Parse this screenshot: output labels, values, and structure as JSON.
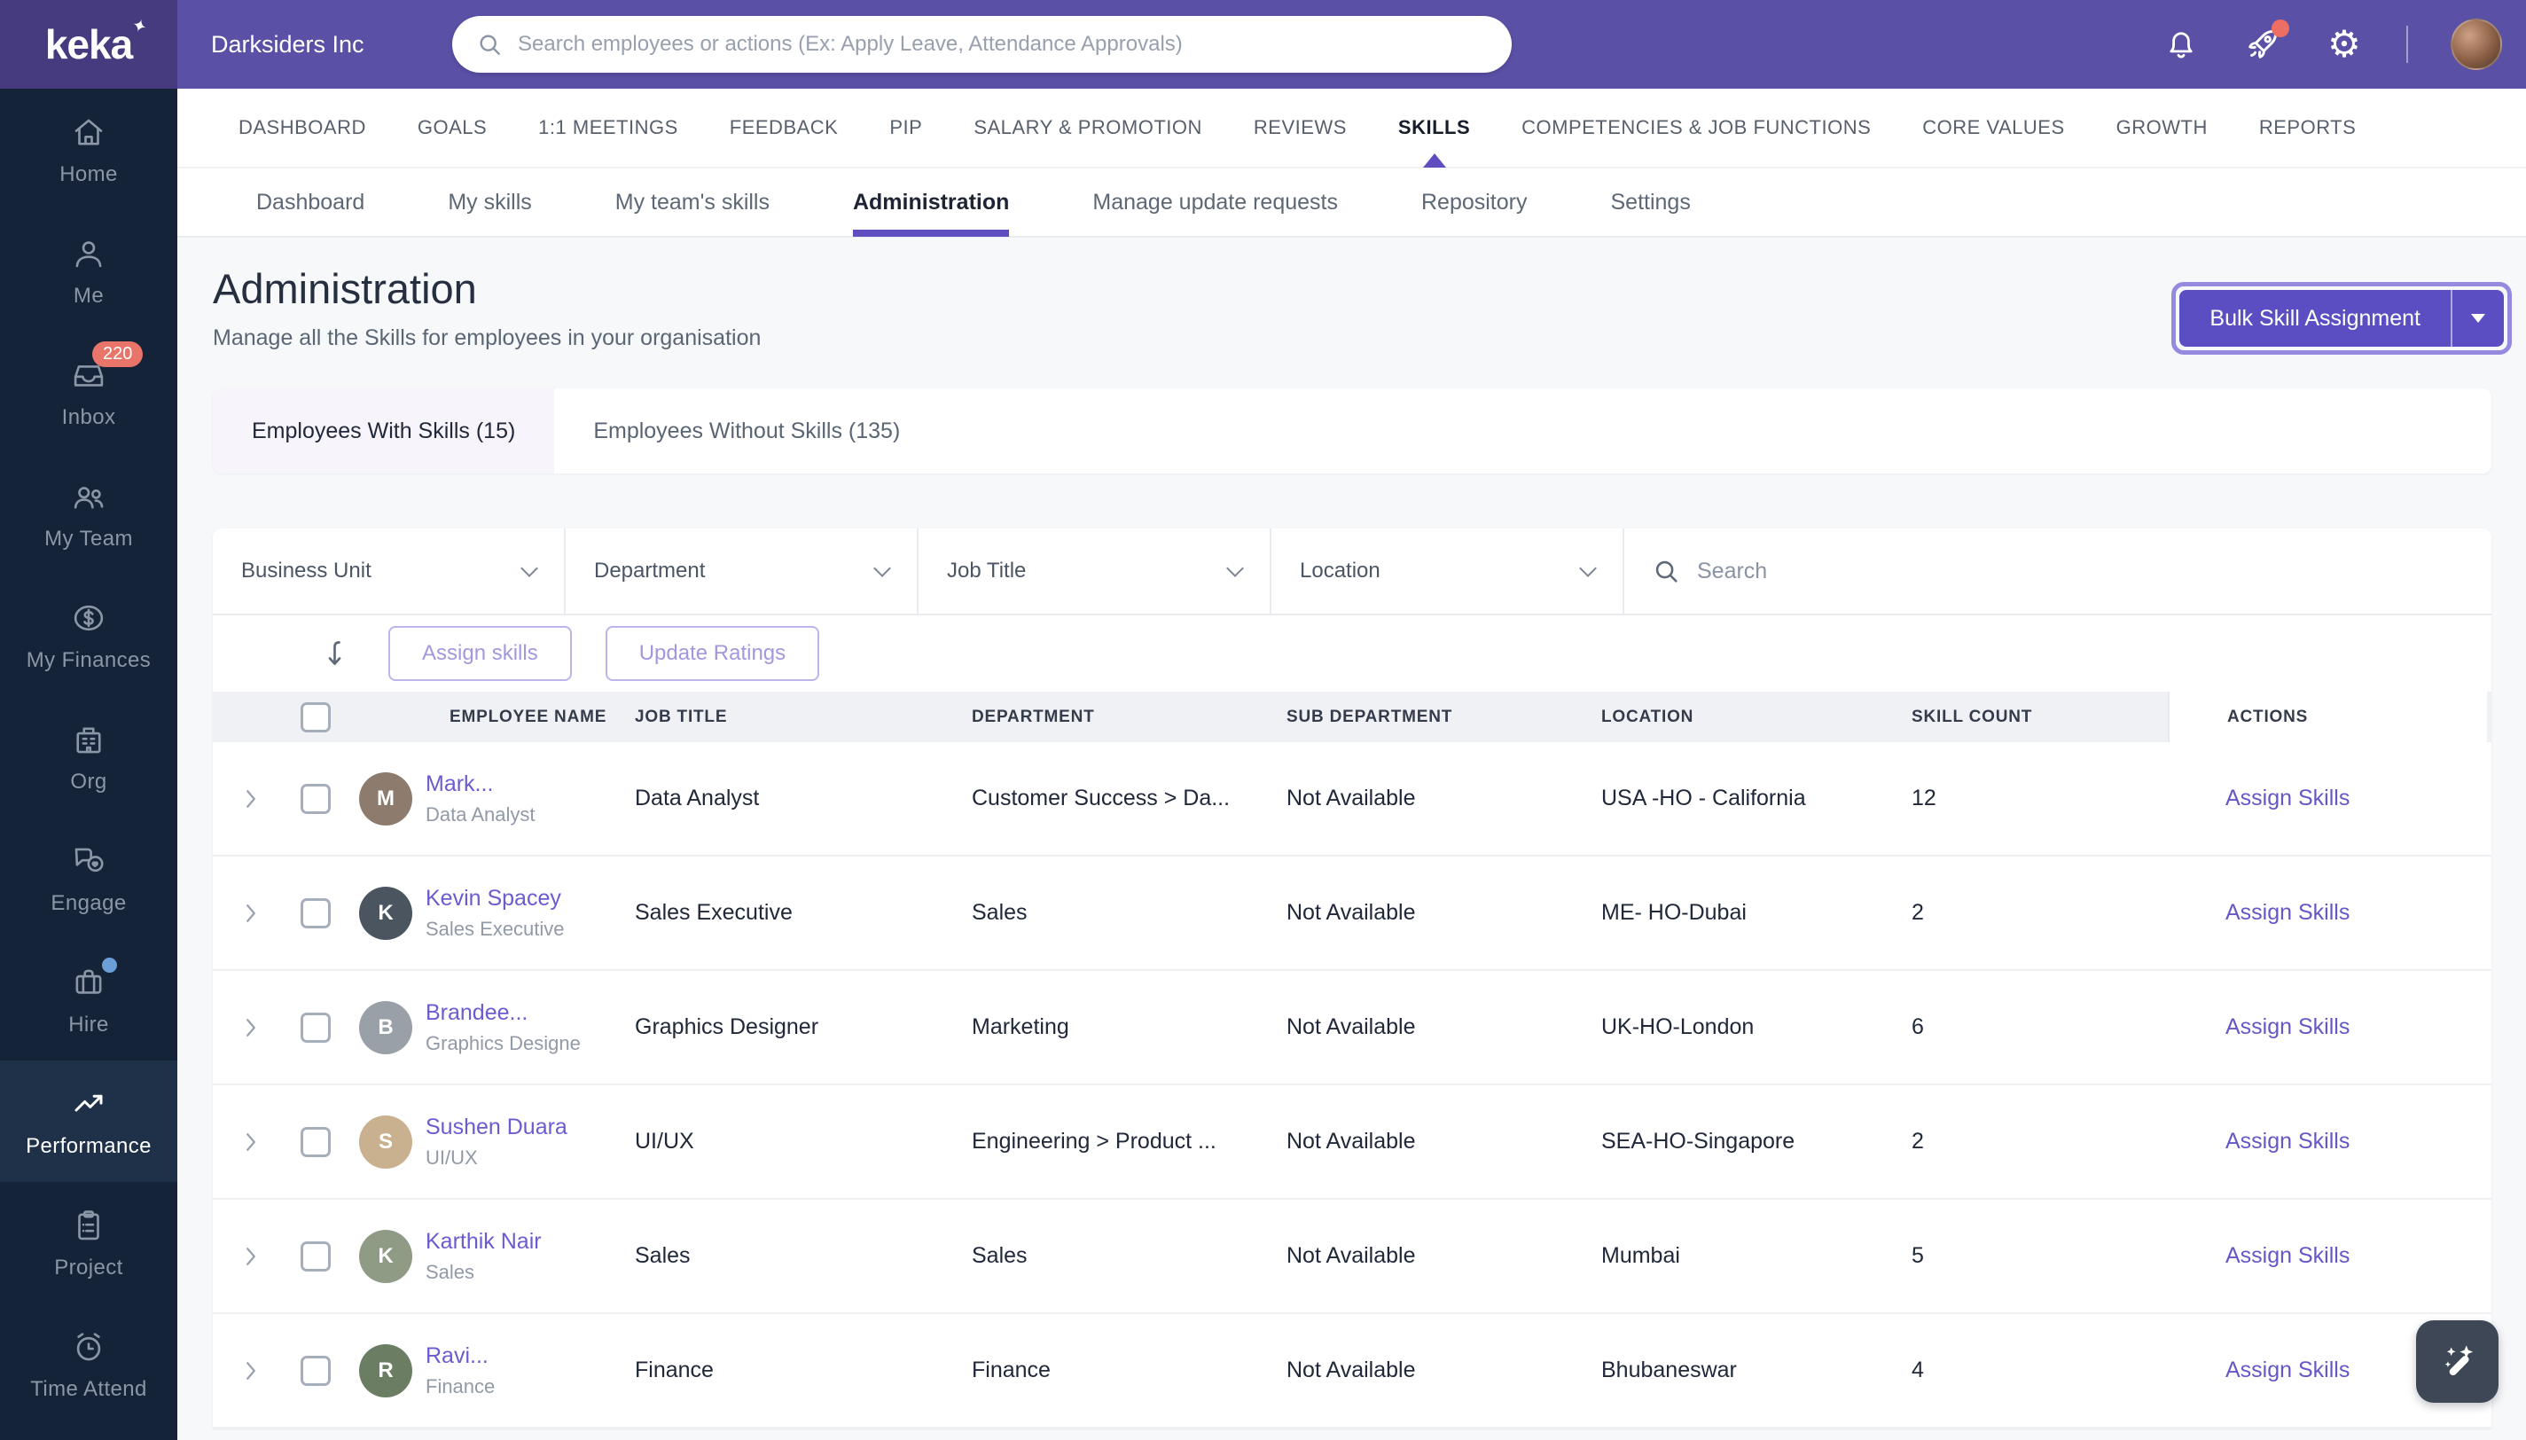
{
  "topbar": {
    "logo": "keka",
    "logo_spark": "✦",
    "company": "Darksiders Inc",
    "search_placeholder": "Search employees or actions (Ex: Apply Leave, Attendance Approvals)",
    "gear_glyph": "⚙"
  },
  "sidebar": {
    "items": [
      {
        "label": "Home"
      },
      {
        "label": "Me"
      },
      {
        "label": "Inbox",
        "badge": "220"
      },
      {
        "label": "My Team"
      },
      {
        "label": "My Finances"
      },
      {
        "label": "Org"
      },
      {
        "label": "Engage"
      },
      {
        "label": "Hire"
      },
      {
        "label": "Performance",
        "active": true
      },
      {
        "label": "Project"
      },
      {
        "label": "Time Attend"
      }
    ]
  },
  "main_nav": {
    "items": [
      "DASHBOARD",
      "GOALS",
      "1:1 MEETINGS",
      "FEEDBACK",
      "PIP",
      "SALARY & PROMOTION",
      "REVIEWS",
      "SKILLS",
      "COMPETENCIES & JOB FUNCTIONS",
      "CORE VALUES",
      "GROWTH",
      "REPORTS"
    ],
    "active": "SKILLS"
  },
  "sub_nav": {
    "items": [
      "Dashboard",
      "My skills",
      "My team's skills",
      "Administration",
      "Manage update requests",
      "Repository",
      "Settings"
    ],
    "active": "Administration"
  },
  "page": {
    "title": "Administration",
    "subtitle": "Manage all the Skills for employees in your organisation",
    "primary_button": "Bulk Skill Assignment"
  },
  "tabs": {
    "with_skills": "Employees With Skills (15)",
    "without_skills": "Employees Without Skills (135)"
  },
  "filters": {
    "business_unit": "Business Unit",
    "department": "Department",
    "job_title": "Job Title",
    "location": "Location",
    "search_placeholder": "Search"
  },
  "toolbar": {
    "assign_label": "Assign skills",
    "update_label": "Update Ratings"
  },
  "table": {
    "headers": [
      "EMPLOYEE NAME",
      "JOB TITLE",
      "DEPARTMENT",
      "SUB DEPARTMENT",
      "LOCATION",
      "SKILL COUNT",
      "ACTIONS"
    ],
    "rows": [
      {
        "initials": "M",
        "avatar_color": "#8d7b6d",
        "name": "Mark...",
        "subtitle": "Data Analyst",
        "job_title": "Data Analyst",
        "department": "Customer Success > Da...",
        "sub_department": "Not Available",
        "location": "USA -HO - California",
        "skill_count": "12",
        "action": "Assign Skills"
      },
      {
        "initials": "K",
        "avatar_color": "#4a5560",
        "name": "Kevin Spacey",
        "subtitle": "Sales Executive",
        "job_title": "Sales Executive",
        "department": "Sales",
        "sub_department": "Not Available",
        "location": "ME- HO-Dubai",
        "skill_count": "2",
        "action": "Assign Skills"
      },
      {
        "initials": "B",
        "avatar_color": "#9aa0a8",
        "name": "Brandee...",
        "subtitle": "Graphics Designe",
        "job_title": "Graphics Designer",
        "department": "Marketing",
        "sub_department": "Not Available",
        "location": "UK-HO-London",
        "skill_count": "6",
        "action": "Assign Skills"
      },
      {
        "initials": "S",
        "avatar_color": "#c9b18f",
        "name": "Sushen Duara",
        "subtitle": "UI/UX",
        "job_title": "UI/UX",
        "department": "Engineering > Product ...",
        "sub_department": "Not Available",
        "location": "SEA-HO-Singapore",
        "skill_count": "2",
        "action": "Assign Skills"
      },
      {
        "initials": "K",
        "avatar_color": "#8f9b85",
        "name": "Karthik Nair",
        "subtitle": "Sales",
        "job_title": "Sales",
        "department": "Sales",
        "sub_department": "Not Available",
        "location": "Mumbai",
        "skill_count": "5",
        "action": "Assign Skills"
      },
      {
        "initials": "R",
        "avatar_color": "#6b7d62",
        "name": "Ravi...",
        "subtitle": "Finance",
        "job_title": "Finance",
        "department": "Finance",
        "sub_department": "Not Available",
        "location": "Bhubaneswar",
        "skill_count": "4",
        "action": "Assign Skills"
      }
    ]
  },
  "colors": {
    "topbar_purple": "#5a50a5",
    "logo_purple": "#463b7e",
    "sidebar_navy": "#152338",
    "accent_purple": "#5a4ec2",
    "link_purple": "#6a5cd0",
    "badge_red": "#e9756a",
    "hire_dot_blue": "#6c9fd8"
  }
}
